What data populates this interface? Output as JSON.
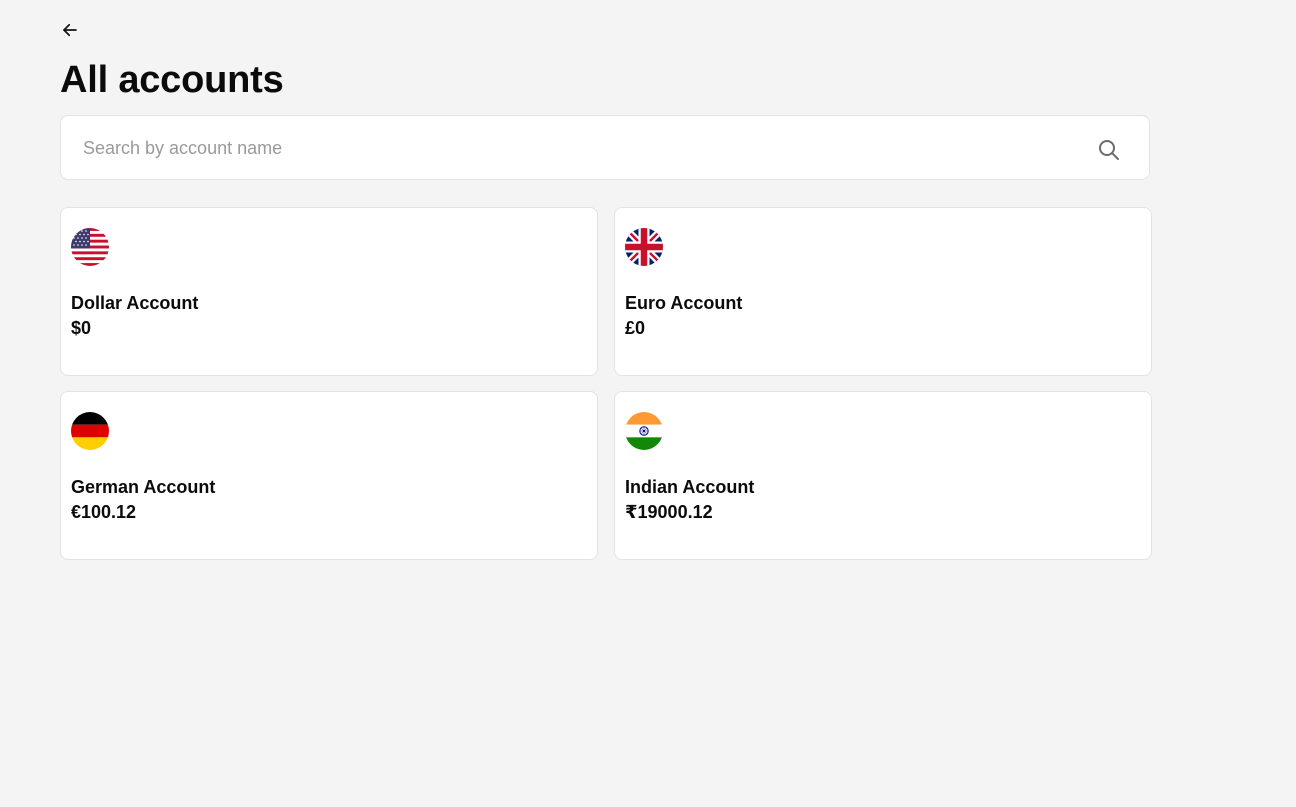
{
  "header": {
    "back_icon": "arrow-left-icon",
    "title": "All accounts"
  },
  "search": {
    "placeholder": "Search by account name",
    "value": "",
    "icon": "search-icon"
  },
  "accounts": [
    {
      "name": "Dollar Account",
      "balance": "$0",
      "flag_icon": "us-flag-icon"
    },
    {
      "name": "Euro Account",
      "balance": "£0",
      "flag_icon": "uk-flag-icon"
    },
    {
      "name": "German Account",
      "balance": "€100.12",
      "flag_icon": "germany-flag-icon"
    },
    {
      "name": "Indian Account",
      "balance": "₹19000.12",
      "flag_icon": "india-flag-icon"
    }
  ],
  "colors": {
    "background": "#f4f4f4",
    "card": "#ffffff",
    "border": "#e3e3e3",
    "text": "#0b0b0b",
    "placeholder": "#9a9a9a"
  }
}
